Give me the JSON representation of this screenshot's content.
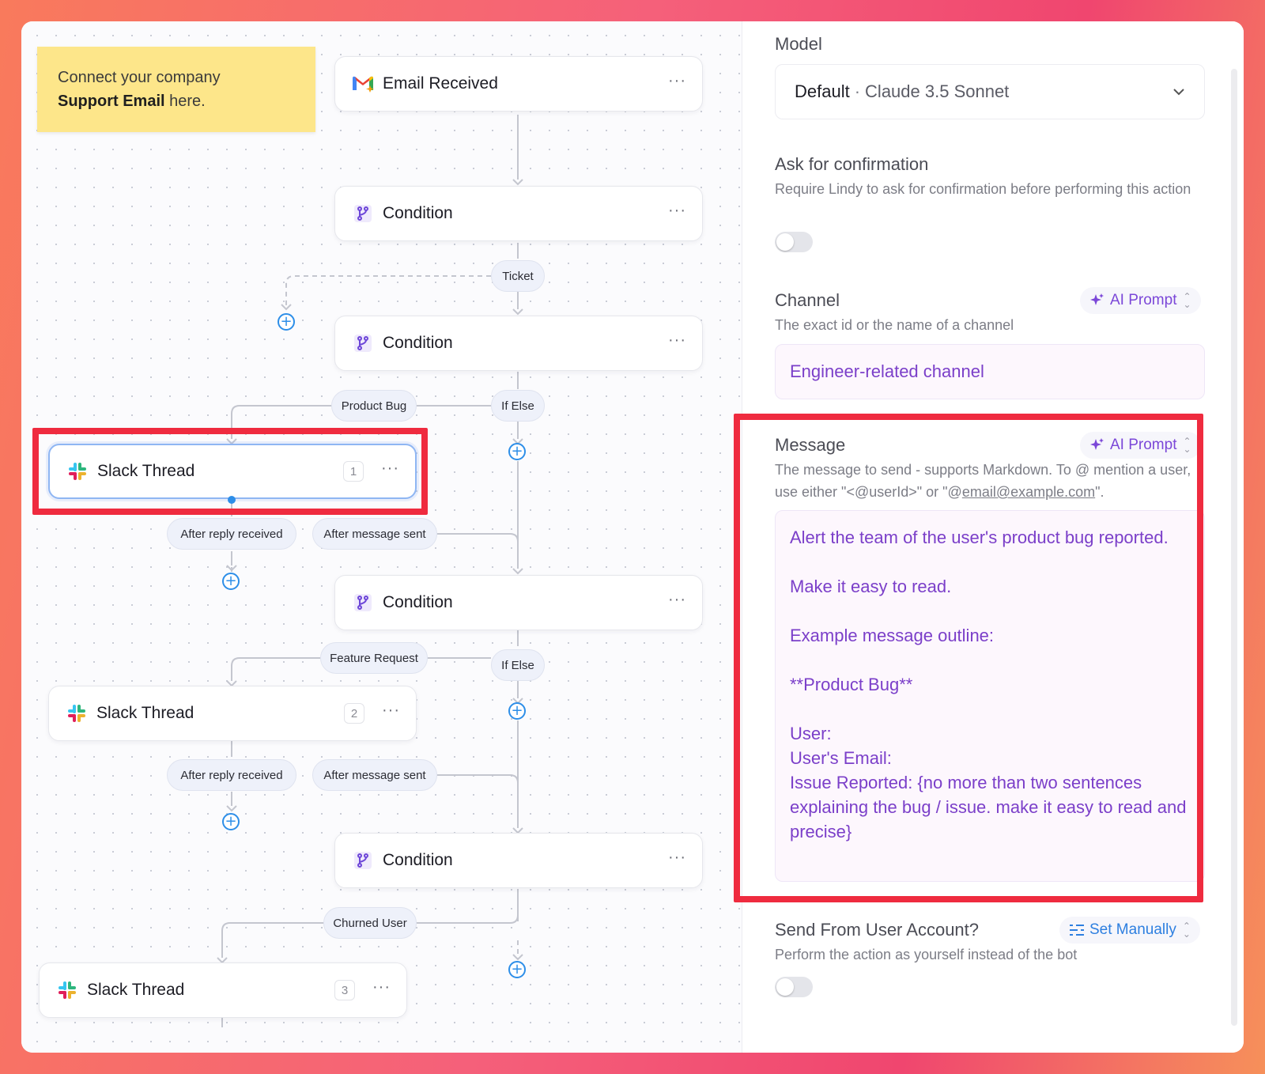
{
  "sticky_note": {
    "line1": "Connect your company",
    "bold": "Support Email",
    "rest": "here."
  },
  "nodes": {
    "email_received": {
      "title": "Email Received",
      "menu": "···"
    },
    "condition_1": {
      "title": "Condition",
      "menu": "···"
    },
    "condition_2": {
      "title": "Condition",
      "menu": "···"
    },
    "condition_3": {
      "title": "Condition",
      "menu": "···"
    },
    "condition_4": {
      "title": "Condition",
      "menu": "···"
    },
    "slack_1": {
      "title": "Slack Thread",
      "badge": "1",
      "menu": "···"
    },
    "slack_2": {
      "title": "Slack Thread",
      "badge": "2",
      "menu": "···"
    },
    "slack_3": {
      "title": "Slack Thread",
      "badge": "3",
      "menu": "···"
    }
  },
  "branches": {
    "ticket": "Ticket",
    "product_bug": "Product Bug",
    "if_else_1": "If Else",
    "after_reply_1": "After reply received",
    "after_message_1": "After message sent",
    "feature_request": "Feature Request",
    "if_else_2": "If Else",
    "after_reply_2": "After reply received",
    "after_message_2": "After message sent",
    "churned_user": "Churned User"
  },
  "add_button_glyph": "+",
  "panel": {
    "model": {
      "label": "Model",
      "default_word": "Default",
      "separator": "·",
      "value": "Claude 3.5 Sonnet"
    },
    "confirmation": {
      "label": "Ask for confirmation",
      "description": "Require Lindy to ask for confirmation before performing this action",
      "enabled": false
    },
    "channel": {
      "label": "Channel",
      "mode": "AI Prompt",
      "description": "The exact id or the name of a channel",
      "value": "Engineer-related channel"
    },
    "message": {
      "label": "Message",
      "mode": "AI Prompt",
      "description_part1": "The message to send - supports Markdown. To @ mention a user, use either \"<@userId>\" or \"@",
      "description_link": "email@example.com",
      "description_part2": "\".",
      "lines": [
        "Alert the team of the user's product bug reported.",
        "",
        "Make it easy to read.",
        "",
        "Example message outline:",
        "",
        "**Product Bug**",
        "",
        "User:",
        "User's Email:",
        "Issue Reported: {no more than two sentences explaining the bug / issue. make it easy to read and precise}"
      ]
    },
    "send_from_user": {
      "label": "Send From User Account?",
      "mode": "Set Manually",
      "description": "Perform the action as yourself instead of the bot",
      "enabled": false
    }
  },
  "colors": {
    "accent_purple": "#7b47d8",
    "highlight_red": "#ef2b3f",
    "plus_blue": "#2d8ee8",
    "sticky_yellow": "#fde68a"
  }
}
